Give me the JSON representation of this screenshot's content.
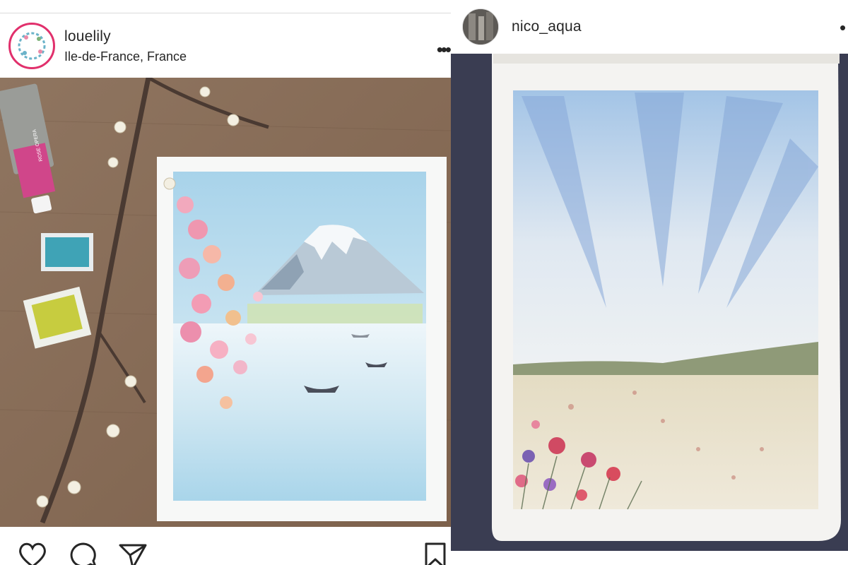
{
  "posts": [
    {
      "username": "louelily",
      "location": "Ile-de-France, France",
      "more_icon": "more-horizontal-icon",
      "photo_subject": "watercolor",
      "tube_label": "ROSE OPERA",
      "actions": [
        "heart-icon",
        "comment-icon",
        "share-icon",
        "bookmark-icon"
      ]
    },
    {
      "username": "nico_aqua",
      "more_icon": "more-horizontal-icon",
      "photo_subject": "watercolor"
    }
  ],
  "colors": {
    "text": "#262626",
    "divider": "#dbdbdb",
    "avatar_ring": "#e1306c",
    "wood": "#8a6d55",
    "sky": "#a9cfe6",
    "sketchbook_bg": "#3a3d52"
  }
}
